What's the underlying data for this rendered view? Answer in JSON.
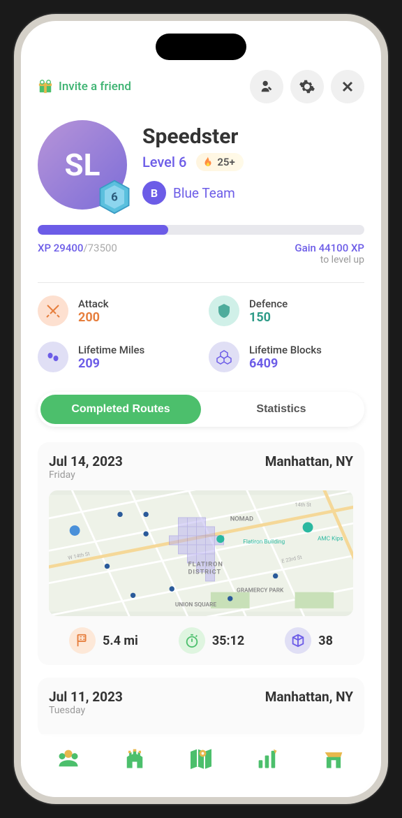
{
  "header": {
    "invite_label": "Invite a friend"
  },
  "profile": {
    "avatar_initials": "SL",
    "level_badge_number": "6",
    "username": "Speedster",
    "level_label": "Level 6",
    "streak": "25+",
    "team_initial": "B",
    "team_name": "Blue Team"
  },
  "xp": {
    "current": "XP 29400",
    "max": "/73500",
    "gain": "Gain 44100 XP",
    "gain_sub": "to level up"
  },
  "stats": {
    "attack": {
      "label": "Attack",
      "value": "200"
    },
    "defence": {
      "label": "Defence",
      "value": "150"
    },
    "miles": {
      "label": "Lifetime Miles",
      "value": "209"
    },
    "blocks": {
      "label": "Lifetime Blocks",
      "value": "6409"
    }
  },
  "tabs": {
    "completed": "Completed Routes",
    "statistics": "Statistics"
  },
  "routes": [
    {
      "date": "Jul 14, 2023",
      "day": "Friday",
      "location": "Manhattan, NY",
      "distance": "5.4 mi",
      "time": "35:12",
      "blocks": "38",
      "map_labels": [
        "NOMAD",
        "Flatiron Building",
        "AMC Kips",
        "FLATIRON DISTRICT",
        "GRAMERCY PARK",
        "UNION SQUARE",
        "W 14th St",
        "E 23rd St",
        "E 14th St"
      ]
    },
    {
      "date": "Jul 11, 2023",
      "day": "Tuesday",
      "location": "Manhattan, NY"
    }
  ]
}
